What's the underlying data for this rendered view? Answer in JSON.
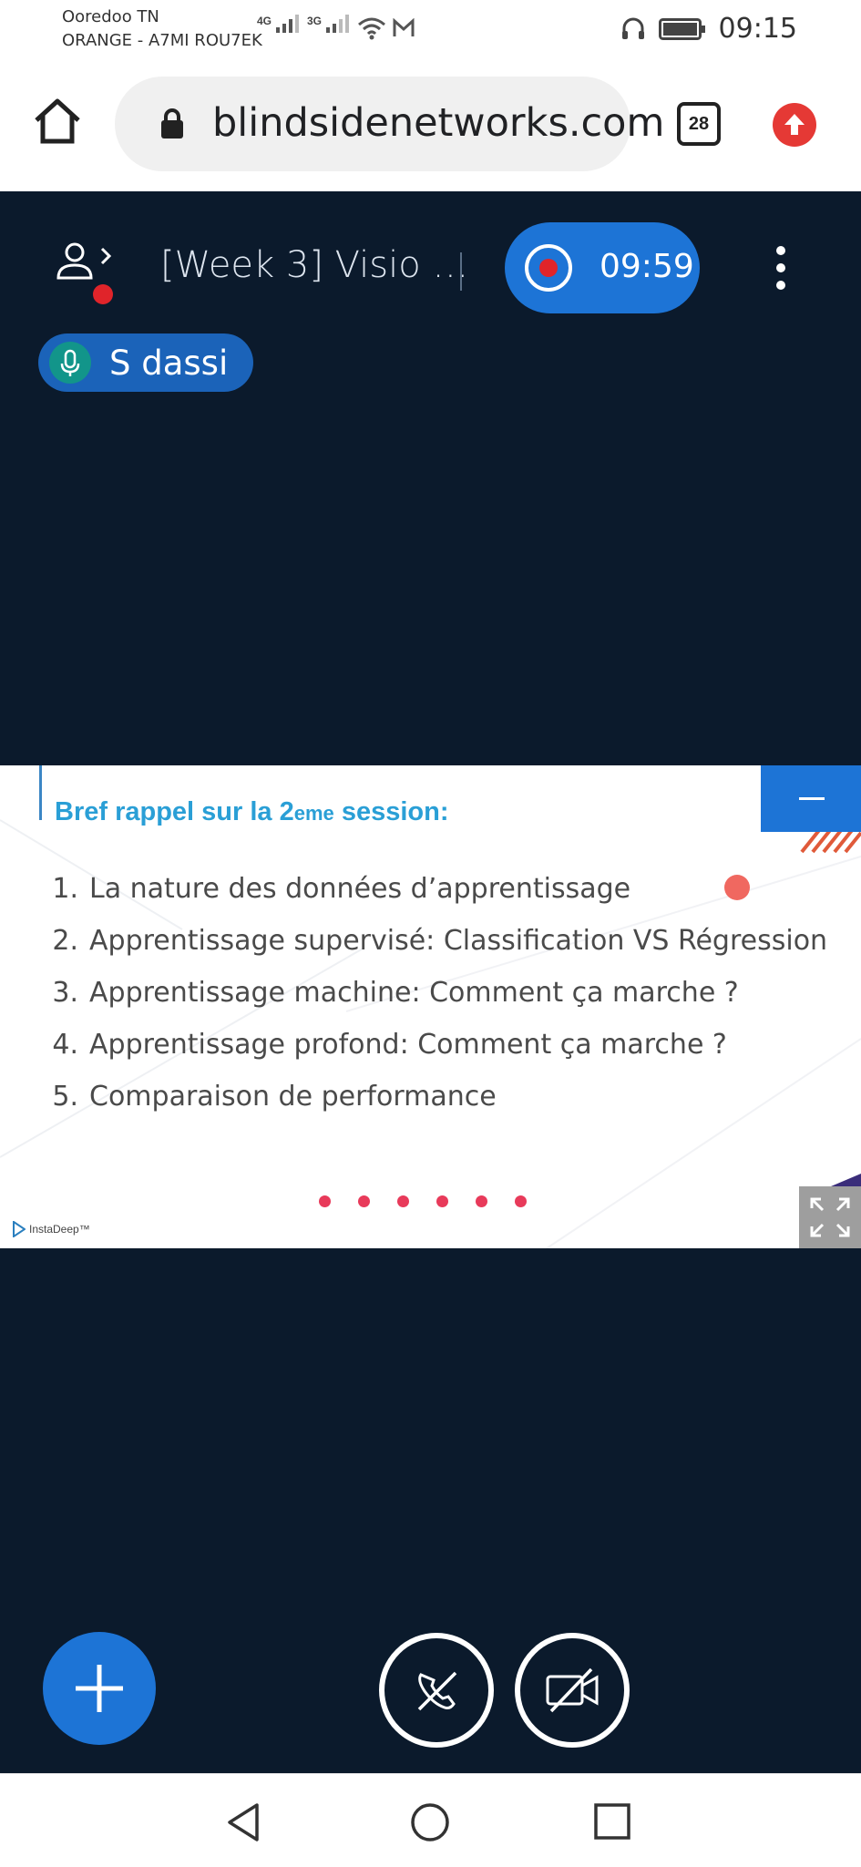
{
  "status_bar": {
    "carrier_1": "Ooredoo TN",
    "carrier_2": "ORANGE - A7MI ROU7EK",
    "network_1": "4G",
    "network_2": "3G",
    "time": "09:15",
    "icons": [
      "signal-icon",
      "wifi-icon",
      "gmail-icon",
      "headphones-icon",
      "battery-icon"
    ]
  },
  "browser": {
    "url": "blindsidenetworks.com",
    "tab_count": "28",
    "icons": [
      "home-icon",
      "lock-icon",
      "update-icon"
    ]
  },
  "meeting": {
    "title": "[Week 3] Visio …",
    "recording_time": "09:59",
    "talking_user": "S dassi"
  },
  "slide": {
    "heading_prefix": "Bref rappel sur la 2",
    "heading_sup": "eme",
    "heading_suffix": " session:",
    "items": [
      {
        "num": "1.",
        "text": "La nature des données d’apprentissage"
      },
      {
        "num": "2.",
        "text": "Apprentissage supervisé: Classification VS Régression"
      },
      {
        "num": "3.",
        "text": "Apprentissage machine: Comment ça marche ?"
      },
      {
        "num": "4.",
        "text": "Apprentissage profond: Comment ça marche ?"
      },
      {
        "num": "5.",
        "text": "Comparaison de performance"
      }
    ],
    "logo": "InstaDeep™"
  },
  "colors": {
    "meeting_bg": "#0b1a2c",
    "accent_blue": "#1d74d6",
    "record_red": "#e0242a",
    "slide_heading": "#2a9fd6",
    "dot_pink": "#e83a5a"
  }
}
